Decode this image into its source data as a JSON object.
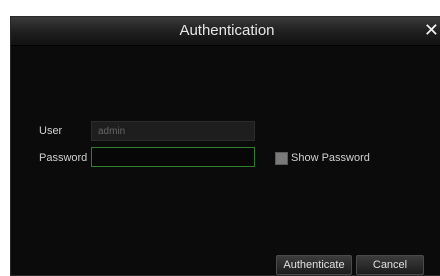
{
  "dialog": {
    "title": "Authentication",
    "close_icon": "close-icon"
  },
  "form": {
    "user_label": "User",
    "user_value": "admin",
    "password_label": "Password",
    "password_value": "",
    "show_password_label": "Show Password",
    "show_password_checked": false
  },
  "buttons": {
    "authenticate_label": "Authenticate",
    "cancel_label": "Cancel"
  },
  "colors": {
    "background": "#0b0b0b",
    "focus_border": "#2f7d2f"
  }
}
